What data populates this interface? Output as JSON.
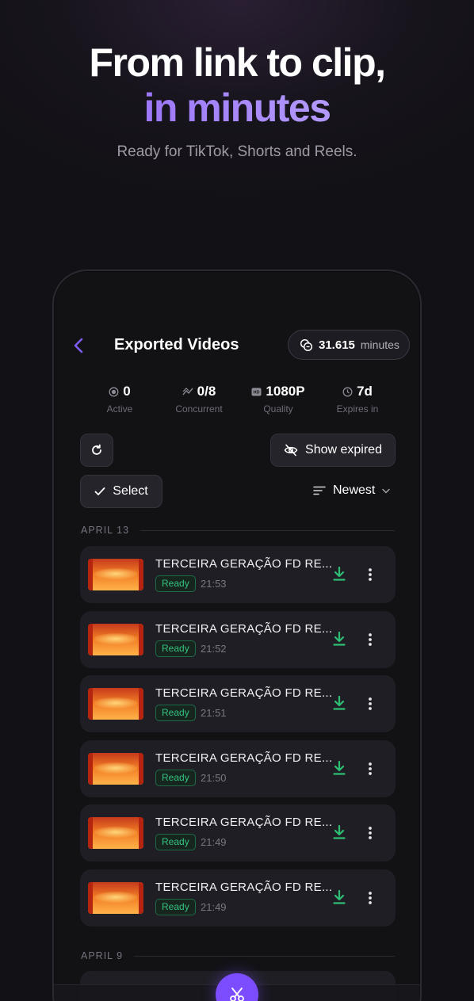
{
  "hero": {
    "line1": "From link to clip,",
    "line2": "in minutes",
    "subtitle": "Ready for TikTok, Shorts and Reels."
  },
  "header": {
    "title": "Exported Videos",
    "minutes_value": "31.615",
    "minutes_unit": "minutes"
  },
  "stats": [
    {
      "value": "0",
      "label": "Active",
      "icon": "circle-dot-icon"
    },
    {
      "value": "0/8",
      "label": "Concurrent",
      "icon": "trend-icon"
    },
    {
      "value": "1080P",
      "label": "Quality",
      "icon": "hd-icon"
    },
    {
      "value": "7d",
      "label": "Expires in",
      "icon": "clock-icon"
    }
  ],
  "toolbar": {
    "show_expired": "Show expired",
    "select": "Select",
    "sort": "Newest"
  },
  "groups": [
    {
      "date": "APRIL 13",
      "items": [
        {
          "title": "TERCEIRA GERAÇÃO FD RE...",
          "status": "Ready",
          "time": "21:53"
        },
        {
          "title": "TERCEIRA GERAÇÃO FD RE...",
          "status": "Ready",
          "time": "21:52"
        },
        {
          "title": "TERCEIRA GERAÇÃO FD RE...",
          "status": "Ready",
          "time": "21:51"
        },
        {
          "title": "TERCEIRA GERAÇÃO FD RE...",
          "status": "Ready",
          "time": "21:50"
        },
        {
          "title": "TERCEIRA GERAÇÃO FD RE...",
          "status": "Ready",
          "time": "21:49"
        },
        {
          "title": "TERCEIRA GERAÇÃO FD RE...",
          "status": "Ready",
          "time": "21:49"
        }
      ]
    },
    {
      "date": "APRIL 9",
      "items": []
    }
  ],
  "colors": {
    "accent": "#7c5cf2",
    "ready": "#34c27f",
    "download": "#2fbf74",
    "background": "#121115"
  }
}
